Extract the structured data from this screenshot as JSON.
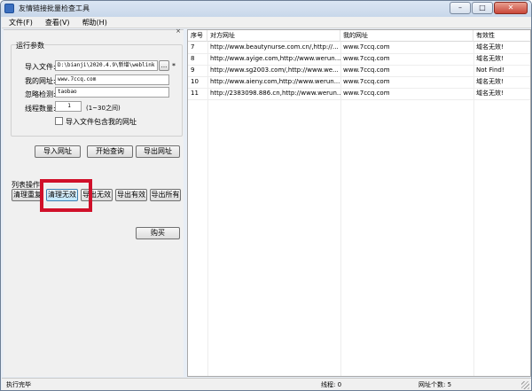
{
  "window": {
    "title": "友情链接批量检查工具",
    "caption": {
      "minimize": "–",
      "maximize": "□",
      "close": "✕"
    }
  },
  "menu": [
    "文件(F)",
    "查看(V)",
    "帮助(H)"
  ],
  "left": {
    "panel_close": "×",
    "group_title": "运行参数",
    "fields": {
      "import_file": {
        "label": "导入文件:",
        "value": "D:\\bianji\\2020.4.9\\新增\\weblink",
        "browse": "...",
        "marker": "*"
      },
      "my_site": {
        "label": "我的网址:",
        "value": "www.7ccq.com"
      },
      "ignore": {
        "label": "忽略检测:",
        "value": "taobao"
      },
      "threads": {
        "label": "线程数量:",
        "value": "1",
        "hint": "(1~30之间)"
      },
      "include_checkbox": {
        "label": "导入文件包含我的网址",
        "checked": false
      }
    },
    "buttons": {
      "import": "导入网址",
      "start": "开始查询",
      "export": "导出网址"
    },
    "list_ops_label": "列表操作:",
    "list_buttons": {
      "clear_dup": "清理重复",
      "clear_invalid": "清理无效",
      "export_invalid": "导出无效",
      "export_valid": "导出有效",
      "export_all": "导出所有"
    },
    "buy": "购买"
  },
  "list": {
    "columns": [
      "序号",
      "对方网址",
      "我的网址",
      "有效性"
    ],
    "rows": [
      {
        "num": "7",
        "their": "http://www.beautynurse.com.cn/,http://...",
        "mine": "www.7ccq.com",
        "status": "域名无效!"
      },
      {
        "num": "8",
        "their": "http://www.ayige.com,http://www.werun...",
        "mine": "www.7ccq.com",
        "status": "域名无效!"
      },
      {
        "num": "9",
        "their": "http://www.sg2003.com/,http://www.we...",
        "mine": "www.7ccq.com",
        "status": "Not Find!"
      },
      {
        "num": "10",
        "their": "http://www.aieny.com,http://www.werun...",
        "mine": "www.7ccq.com",
        "status": "域名无效!"
      },
      {
        "num": "11",
        "their": "http://2383098.886.cn,http://www.werun...",
        "mine": "www.7ccq.com",
        "status": "域名无效!"
      }
    ]
  },
  "status": {
    "state": "执行完毕",
    "threads": "线程: 0",
    "count": "网址个数: 5"
  },
  "colors": {
    "highlight": "#d0102a"
  }
}
